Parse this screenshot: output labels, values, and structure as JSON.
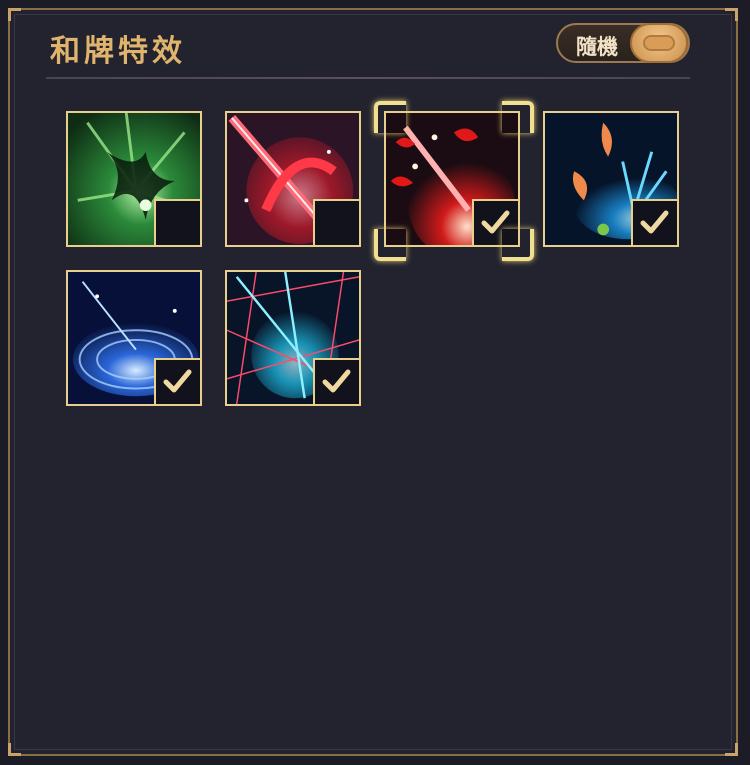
{
  "panel": {
    "title": "和牌特效",
    "random_toggle": {
      "label": "隨機",
      "state": "on"
    }
  },
  "effects": [
    {
      "id": "green",
      "theme": "green vortex",
      "selected": false,
      "focused": false,
      "colors": [
        "#0e2d14",
        "#2b8a3a",
        "#b6f0a6"
      ]
    },
    {
      "id": "crimson",
      "theme": "red slash",
      "selected": false,
      "focused": false,
      "colors": [
        "#2a1426",
        "#c21a2a",
        "#ff9aa8"
      ]
    },
    {
      "id": "flame",
      "theme": "red feathers",
      "selected": true,
      "focused": true,
      "colors": [
        "#1a0c12",
        "#d01a1a",
        "#ffe0c8"
      ]
    },
    {
      "id": "koi",
      "theme": "koi splash",
      "selected": true,
      "focused": false,
      "colors": [
        "#06142a",
        "#1a8fd8",
        "#f08a4a"
      ]
    },
    {
      "id": "ripple",
      "theme": "blue ripple",
      "selected": true,
      "focused": false,
      "colors": [
        "#061038",
        "#2a66d8",
        "#d8ecff"
      ]
    },
    {
      "id": "laser",
      "theme": "laser grid",
      "selected": true,
      "focused": false,
      "colors": [
        "#081428",
        "#20c8f0",
        "#ff4a6a"
      ]
    }
  ],
  "accent": "#e0b46d",
  "icons": {
    "check": "check-icon"
  }
}
